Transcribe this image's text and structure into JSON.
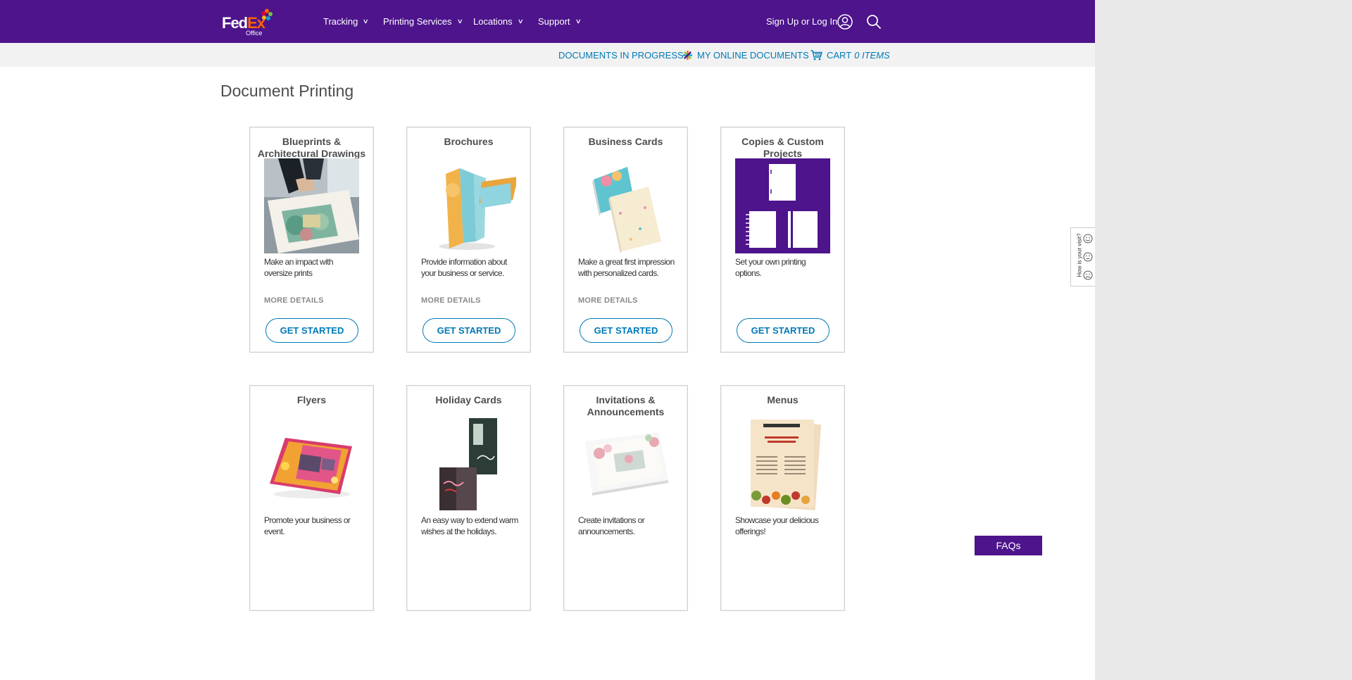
{
  "header": {
    "logo_text_fed": "Fed",
    "logo_text_ex": "Ex",
    "logo_sub": "Office",
    "nav": [
      {
        "label": "Tracking"
      },
      {
        "label": "Printing Services"
      },
      {
        "label": "Locations"
      },
      {
        "label": "Support"
      }
    ],
    "signin_label": "Sign Up or Log In"
  },
  "subnav": {
    "in_progress": "DOCUMENTS IN PROGRESS",
    "online_docs": "MY ONLINE DOCUMENTS",
    "cart": "CART",
    "cart_count": "0 ITEMS"
  },
  "page_title": "Document Printing",
  "cards": [
    {
      "title": "Blueprints & Architectural Drawings",
      "desc": "Make an impact with oversize prints",
      "more": "MORE DETAILS",
      "button": "GET STARTED"
    },
    {
      "title": "Brochures",
      "desc": "Provide information about your business or service.",
      "more": "MORE DETAILS",
      "button": "GET STARTED"
    },
    {
      "title": "Business Cards",
      "desc": "Make a great first impression with personalized cards.",
      "more": "MORE DETAILS",
      "button": "GET STARTED"
    },
    {
      "title": "Copies & Custom Projects",
      "desc": "Set your own printing options.",
      "more": "",
      "button": "GET STARTED"
    },
    {
      "title": "Flyers",
      "desc": "Promote your business or event.",
      "more": "",
      "button": ""
    },
    {
      "title": "Holiday Cards",
      "desc": "An easy way to extend warm wishes at the holidays.",
      "more": "",
      "button": ""
    },
    {
      "title": "Invitations & Announcements",
      "desc": "Create invitations or announcements.",
      "more": "",
      "button": ""
    },
    {
      "title": "Menus",
      "desc": "Showcase your delicious offerings!",
      "more": "",
      "button": ""
    }
  ],
  "feedback_label": "How is your visit?",
  "faqs_label": "FAQs",
  "colors": {
    "brand_purple": "#4d148c",
    "brand_orange": "#ff6200",
    "link_blue": "#007ab7"
  }
}
